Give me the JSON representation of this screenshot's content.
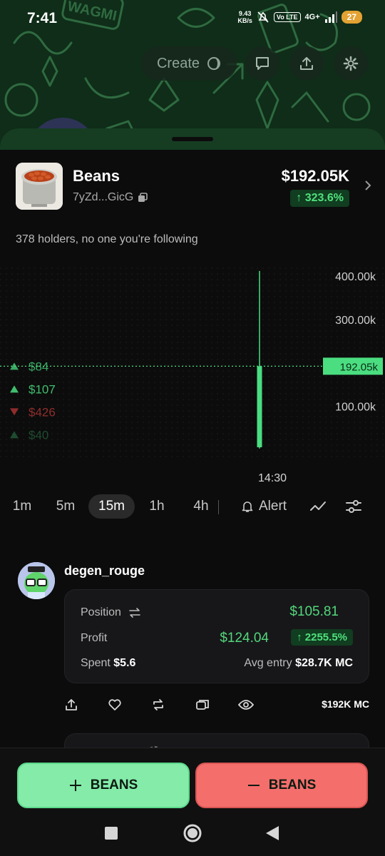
{
  "status": {
    "time": "7:41",
    "speed_top": "9.43",
    "speed_bottom": "KB/s",
    "volte": "Vo LTE",
    "network": "4G+",
    "battery": "27"
  },
  "header": {
    "create_label": "Create"
  },
  "token": {
    "name": "Beans",
    "address": "7yZd...GicG",
    "market_cap": "$192.05K",
    "change": "↑ 323.6%"
  },
  "holders_text": "378 holders, no one you're following",
  "chart": {
    "y_ticks": [
      "400.00k",
      "300.00k",
      "100.00k"
    ],
    "current_label": "192.05k",
    "x_label": "14:30",
    "trades": [
      {
        "dir": "up",
        "amount": "$84"
      },
      {
        "dir": "up",
        "amount": "$107"
      },
      {
        "dir": "down",
        "amount": "$426"
      },
      {
        "dir": "up",
        "amount": "$40"
      }
    ],
    "colors": {
      "up": "#4ade80",
      "down": "#c73b3b",
      "price_line": "#4ade80"
    }
  },
  "chart_data": {
    "type": "candlestick",
    "ylim": [
      0,
      420000
    ],
    "ticks": [
      400000,
      300000,
      100000
    ],
    "candles": [
      {
        "time": "14:30",
        "open": 5000,
        "high": 412000,
        "low": 2000,
        "close": 192050
      }
    ],
    "current_price": 192050
  },
  "timeframes": {
    "items": [
      "1m",
      "5m",
      "15m",
      "1h",
      "4h"
    ],
    "active": "15m",
    "alert_label": "Alert"
  },
  "trader": {
    "name": "degen_rouge",
    "position_label": "Position",
    "position_value": "$105.81",
    "profit_label": "Profit",
    "profit_value": "$124.04",
    "profit_change": "↑ 2255.5%",
    "spent_label": "Spent",
    "spent_value": "$5.6",
    "avg_label": "Avg entry",
    "avg_value": "$28.7K MC",
    "mc_label": "$192K MC"
  },
  "bottom": {
    "buy_label": "BEANS",
    "sell_label": "BEANS"
  },
  "colors": {
    "buy": "#84eba9",
    "sell": "#f46e6c",
    "accent_green": "#4fe07c"
  }
}
